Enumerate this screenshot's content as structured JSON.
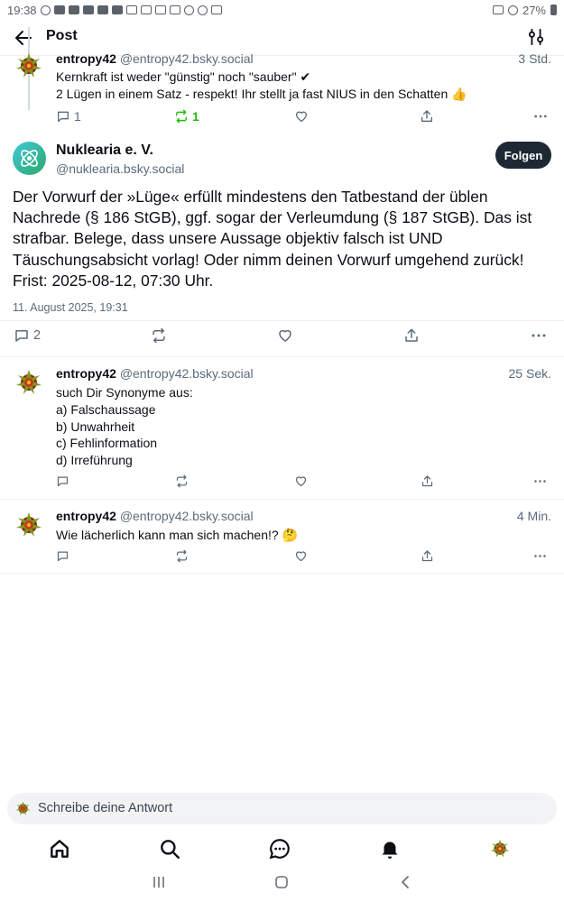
{
  "statusbar": {
    "time": "19:38",
    "battery": "27%"
  },
  "header": {
    "title": "Post"
  },
  "parent_post": {
    "author": "entropy42",
    "handle": "@entropy42.bsky.social",
    "time": "3 Std.",
    "lines": [
      "Kernkraft ist weder \"günstig\" noch \"sauber\" ✔",
      "2 Lügen in einem Satz - respekt! Ihr stellt ja fast NIUS in den Schatten 👍"
    ],
    "reply_count": "1",
    "repost_count": "1"
  },
  "focus_post": {
    "author": "Nuklearia e. V.",
    "handle": "@nuklearia.bsky.social",
    "follow_label": "Folgen",
    "text": "Der Vorwurf der »Lüge« erfüllt mindestens den Tatbestand der üblen Nachrede (§ 186 StGB), ggf. sogar der Verleumdung (§ 187 StGB). Das ist strafbar. Belege, dass unsere Aussage objektiv falsch ist UND Täuschungsabsicht vorlag! Oder nimm deinen Vorwurf umgehend zurück! Frist: 2025-08-12, 07:30 Uhr.",
    "date": "11. August 2025, 19:31",
    "reply_count": "2"
  },
  "replies": [
    {
      "author": "entropy42",
      "handle": "@entropy42.bsky.social",
      "time": "25 Sek.",
      "lines": [
        "such Dir Synonyme aus:",
        "a) Falschaussage",
        "b) Unwahrheit",
        "c) Fehlinformation",
        "d) Irreführung"
      ]
    },
    {
      "author": "entropy42",
      "handle": "@entropy42.bsky.social",
      "time": "4 Min.",
      "lines": [
        "Wie lächerlich kann man sich machen!? 🤔"
      ]
    }
  ],
  "composer": {
    "placeholder": "Schreibe deine Antwort"
  },
  "colors": {
    "accent": "#1e2833",
    "muted": "#5b6b7a",
    "repost_active": "#20bc07"
  },
  "icons": [
    "back-arrow-icon",
    "filter-icon",
    "reply-icon",
    "repost-icon",
    "like-icon",
    "share-icon",
    "more-icon",
    "home-icon",
    "search-icon",
    "chat-icon",
    "bell-icon"
  ]
}
